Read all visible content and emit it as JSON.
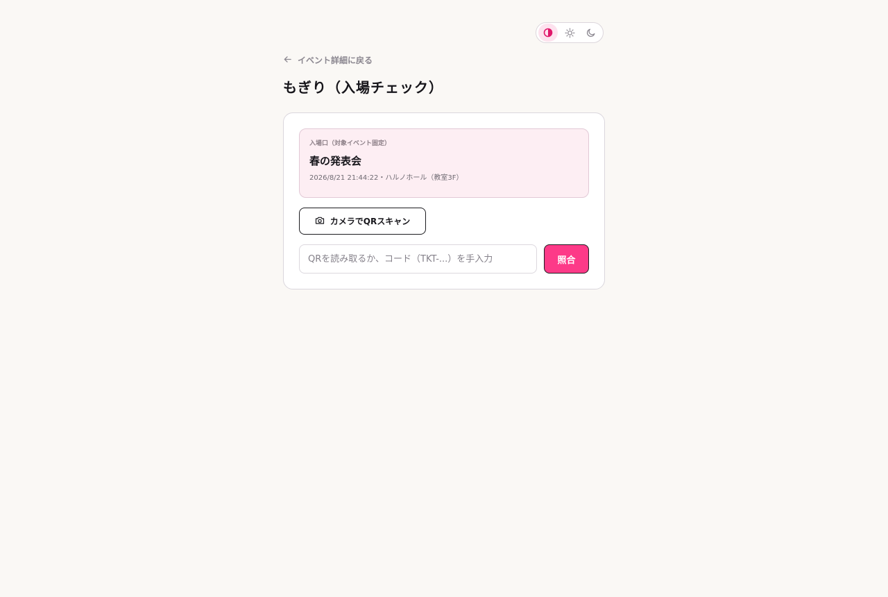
{
  "theme": {
    "options": [
      {
        "name": "contrast",
        "icon": "half-circle-icon",
        "active": true
      },
      {
        "name": "light",
        "icon": "sun-icon",
        "active": false
      },
      {
        "name": "dark",
        "icon": "moon-icon",
        "active": false
      }
    ]
  },
  "nav": {
    "back_label": "イベント詳細に戻る",
    "back_icon": "arrow-left-icon"
  },
  "page": {
    "title": "もぎり（入場チェック）"
  },
  "event": {
    "label": "入場口（対象イベント固定）",
    "name": "春の発表会",
    "meta": "2026/8/21 21:44:22・ハルノホール（教室3F）"
  },
  "scan": {
    "button_label": "カメラでQRスキャン",
    "icon": "camera-icon"
  },
  "code": {
    "value": "",
    "placeholder": "QRを読み取るか、コード（TKT-...）を手入力"
  },
  "verify": {
    "button_label": "照合"
  },
  "colors": {
    "accent": "#fd3a88",
    "accent_soft": "#fde2ee",
    "event_bg": "#fdeef3",
    "page_bg": "#faf8f5"
  }
}
